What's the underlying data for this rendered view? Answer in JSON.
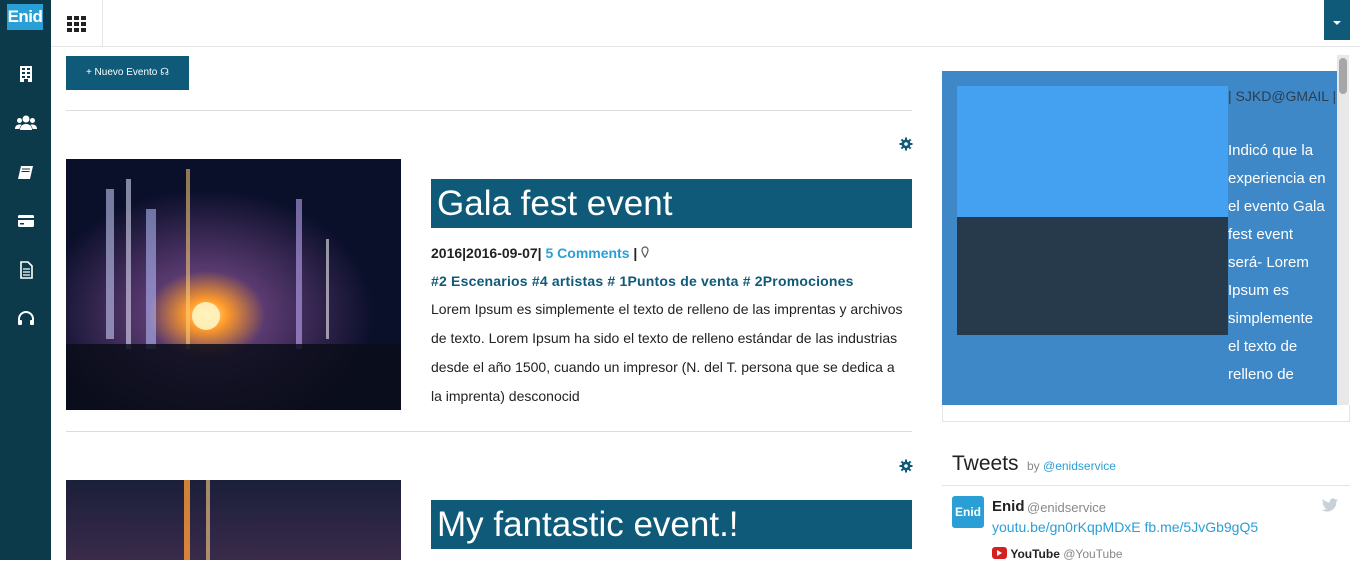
{
  "app": {
    "logo_text": "Enid",
    "brand_color": "#0e5a78",
    "sidebar_color": "#0d3a4a",
    "accent_color": "#2a9fd6"
  },
  "sidebar": {
    "items": [
      {
        "icon": "building-icon"
      },
      {
        "icon": "users-icon"
      },
      {
        "icon": "book-icon"
      },
      {
        "icon": "credit-card-icon"
      },
      {
        "icon": "document-icon"
      },
      {
        "icon": "headset-icon"
      }
    ]
  },
  "toolbar": {
    "new_event_label": "+ Nuevo Evento ☊"
  },
  "events": [
    {
      "title": "Gala fest event",
      "date": "2016|2016-09-07|",
      "comments": "5 Comments",
      "separator": " | ",
      "tags": "#2 Escenarios #4 artistas # 1Puntos de venta # 2Promociones",
      "description": "Lorem Ipsum es simplemente el texto de relleno de las imprentas y archivos de texto. Lorem Ipsum ha sido el texto de relleno estándar de las industrias desde el año 1500, cuando un impresor (N. del T. persona que se dedica a la imprenta) desconocid"
    },
    {
      "title": "My fantastic event.!"
    }
  ],
  "testimonial": {
    "email": "| SJKD@GMAIL |",
    "text": "Indicó que la experiencia en el evento Gala fest event será- Lorem Ipsum es simplemente el texto de relleno de"
  },
  "tweets": {
    "heading": "Tweets",
    "by_label": "by",
    "by_handle": "@enidservice",
    "items": [
      {
        "avatar": "Enid",
        "name": "Enid",
        "handle": "@enidservice",
        "links": "youtu.be/gn0rKqpMDxE fb.me/5JvGb9gQ5",
        "retweet_name": "YouTube",
        "retweet_handle": "@YouTube"
      }
    ]
  }
}
